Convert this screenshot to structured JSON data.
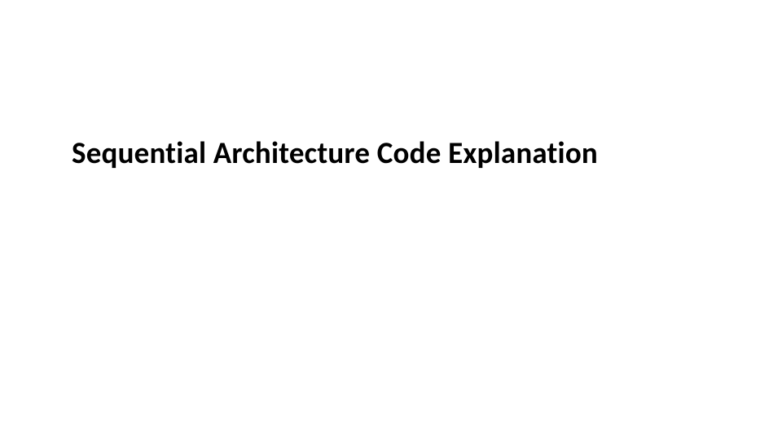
{
  "slide": {
    "title": "Sequential Architecture Code Explanation"
  }
}
